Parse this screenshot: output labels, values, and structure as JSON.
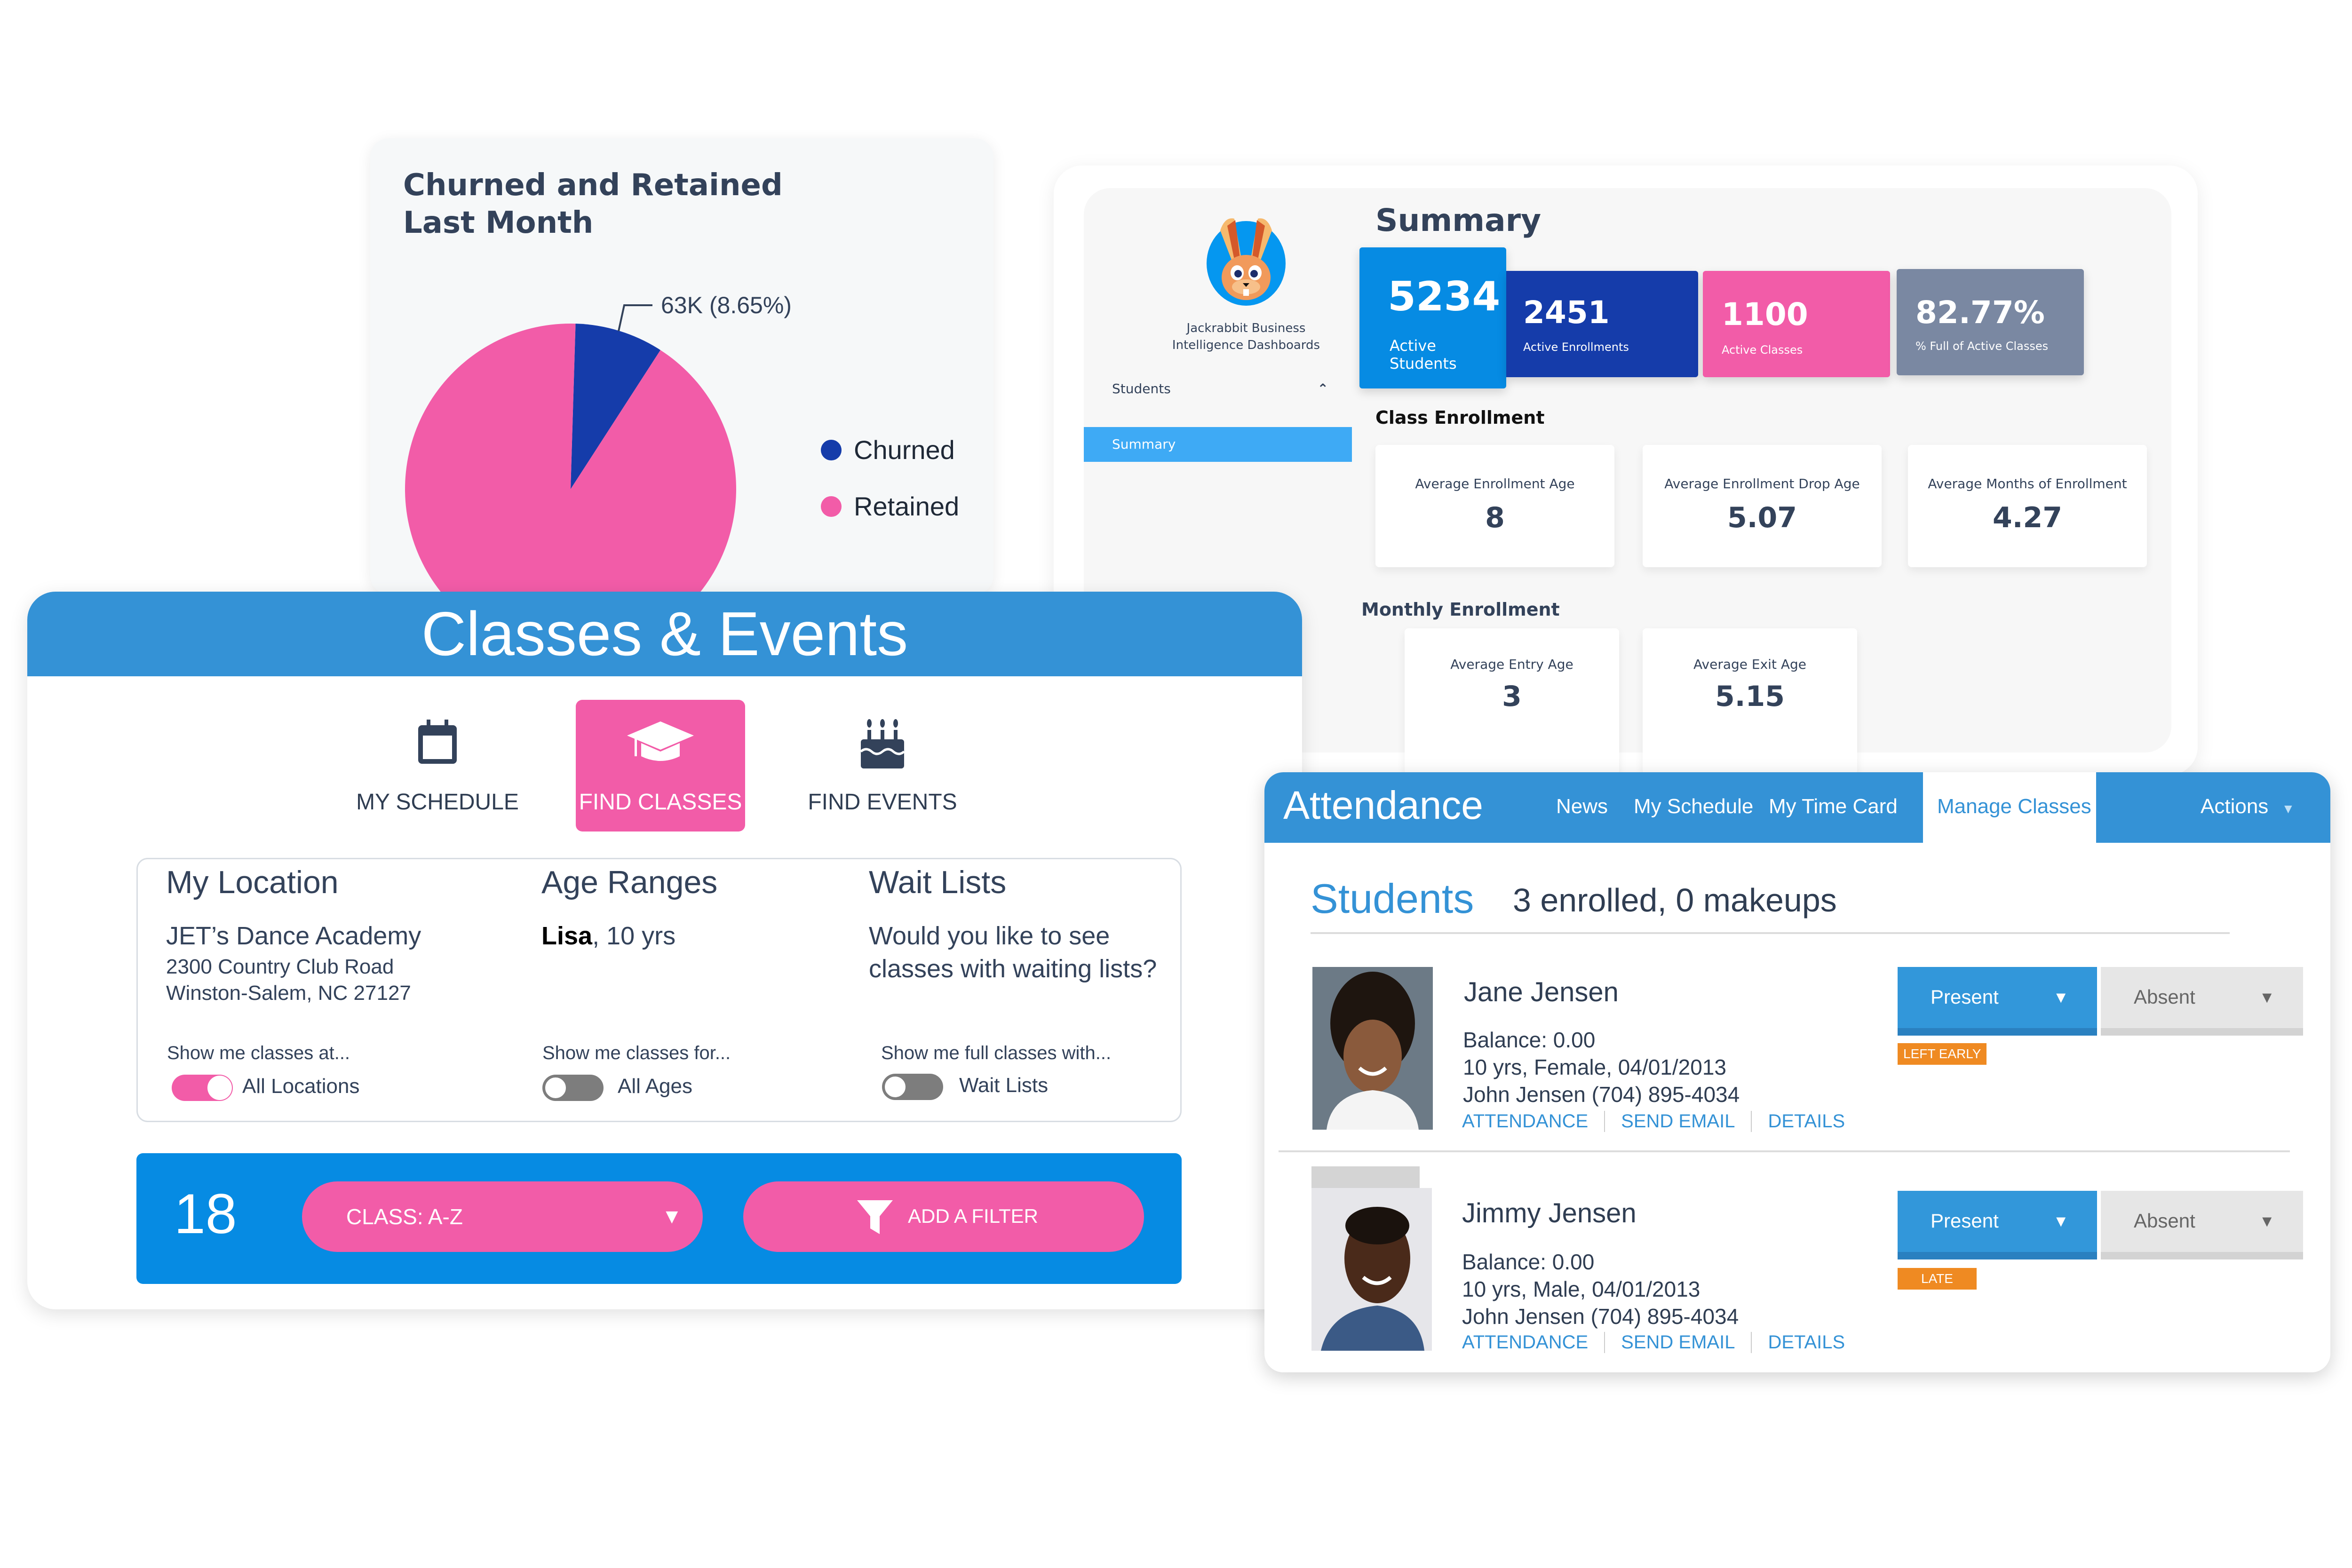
{
  "pie_card": {
    "title_line1": "Churned and Retained",
    "title_line2": "Last Month",
    "chart_data": {
      "type": "pie",
      "title": "Churned and Retained Last Month",
      "categories": [
        "Churned",
        "Retained"
      ],
      "values": [
        8.65,
        91.35
      ],
      "units": "percent",
      "annotations": [
        {
          "category": "Churned",
          "text": "63K (8.65%)"
        }
      ],
      "colors": {
        "Churned": "#153caa",
        "Retained": "#f25ca8"
      },
      "legend_position": "right"
    },
    "slice_label": "63K (8.65%)",
    "legend": [
      {
        "label": "Churned",
        "color": "#153caa"
      },
      {
        "label": "Retained",
        "color": "#f25ca8"
      }
    ]
  },
  "summary": {
    "brand_line1": "Jackrabbit Business",
    "brand_line2": "Intelligence Dashboards",
    "nav_students": "Students",
    "nav_summary": "Summary",
    "title": "Summary",
    "kpis": [
      {
        "value": "5234",
        "label": "Active Students",
        "color": "#068be3"
      },
      {
        "value": "2451",
        "label": "Active Enrollments",
        "color": "#153caa"
      },
      {
        "value": "1100",
        "label": "Active Classes",
        "color": "#f25ca8"
      },
      {
        "value": "82.77%",
        "label": "% Full of Active Classes",
        "color": "#7a88a2"
      }
    ],
    "class_enrollment_heading": "Class Enrollment",
    "class_enrollment": [
      {
        "label": "Average Enrollment Age",
        "value": "8"
      },
      {
        "label": "Average Enrollment Drop Age",
        "value": "5.07"
      },
      {
        "label": "Average Months of Enrollment",
        "value": "4.27"
      }
    ],
    "monthly_enrollment_heading": "Monthly Enrollment",
    "monthly_enrollment": [
      {
        "label": "Average Entry Age",
        "value": "3"
      },
      {
        "label": "Average Exit Age",
        "value": "5.15"
      }
    ]
  },
  "classes": {
    "title": "Classes & Events",
    "tabs": [
      {
        "label": "MY SCHEDULE",
        "icon": "calendar-icon",
        "active": false
      },
      {
        "label": "FIND CLASSES",
        "icon": "graduation-cap-icon",
        "active": true
      },
      {
        "label": "FIND EVENTS",
        "icon": "birthday-cake-icon",
        "active": false
      }
    ],
    "location": {
      "heading": "My Location",
      "name": "JET’s Dance Academy",
      "address1": "2300 Country Club Road",
      "address2": "Winston-Salem, NC 27127",
      "toggle_caption": "Show me classes at...",
      "toggle_label": "All Locations",
      "toggle_on": true
    },
    "ages": {
      "heading": "Age Ranges",
      "student_name": "Lisa",
      "student_age": ", 10 yrs",
      "toggle_caption": "Show me classes for...",
      "toggle_label": "All Ages",
      "toggle_on": false
    },
    "waitlists": {
      "heading": "Wait Lists",
      "question_line1": "Would you like to see",
      "question_line2": "classes with waiting lists?",
      "toggle_caption": "Show me full classes with...",
      "toggle_label": "Wait Lists",
      "toggle_on": false
    },
    "result_count": "18",
    "sort_select": "CLASS: A-Z",
    "add_filter": "ADD A FILTER"
  },
  "attendance": {
    "title": "Attendance",
    "nav": [
      "News",
      "My Schedule",
      "My Time Card",
      "Manage Classes"
    ],
    "nav_active": "Manage Classes",
    "actions": "Actions",
    "students_heading": "Students",
    "students_summary": "3 enrolled, 0 makeups",
    "students": [
      {
        "name": "Jane Jensen",
        "balance": "Balance: 0.00",
        "details": "10 yrs, Female, 04/01/2013",
        "contact": "John Jensen (704) 895-4034",
        "status": "Present",
        "alt_status": "Absent",
        "badge": "LEFT EARLY"
      },
      {
        "name": "Jimmy Jensen",
        "balance": "Balance: 0.00",
        "details": "10 yrs, Male, 04/01/2013",
        "contact": "John Jensen (704) 895-4034",
        "status": "Present",
        "alt_status": "Absent",
        "badge": "LATE"
      }
    ],
    "links": [
      "ATTENDANCE",
      "SEND EMAIL",
      "DETAILS"
    ]
  }
}
